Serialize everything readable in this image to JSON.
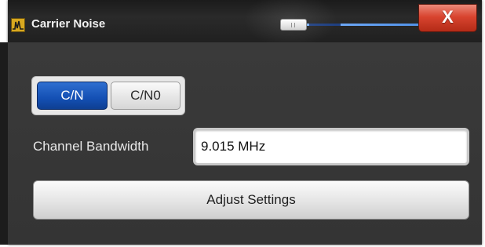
{
  "window": {
    "title": "Carrier Noise",
    "close_glyph": "X",
    "icon": "spectrum-app-icon",
    "close_color": "#d8442f",
    "transparency_slider": {
      "icon": "slider-thumb"
    }
  },
  "mode_toggle": {
    "options": [
      {
        "label": "C/N",
        "selected": true
      },
      {
        "label": "C/N0",
        "selected": false
      }
    ],
    "selected_color": "#1450b4"
  },
  "channel_bandwidth": {
    "label": "Channel Bandwidth",
    "value": "9.015 MHz"
  },
  "adjust_settings": {
    "label": "Adjust Settings"
  }
}
